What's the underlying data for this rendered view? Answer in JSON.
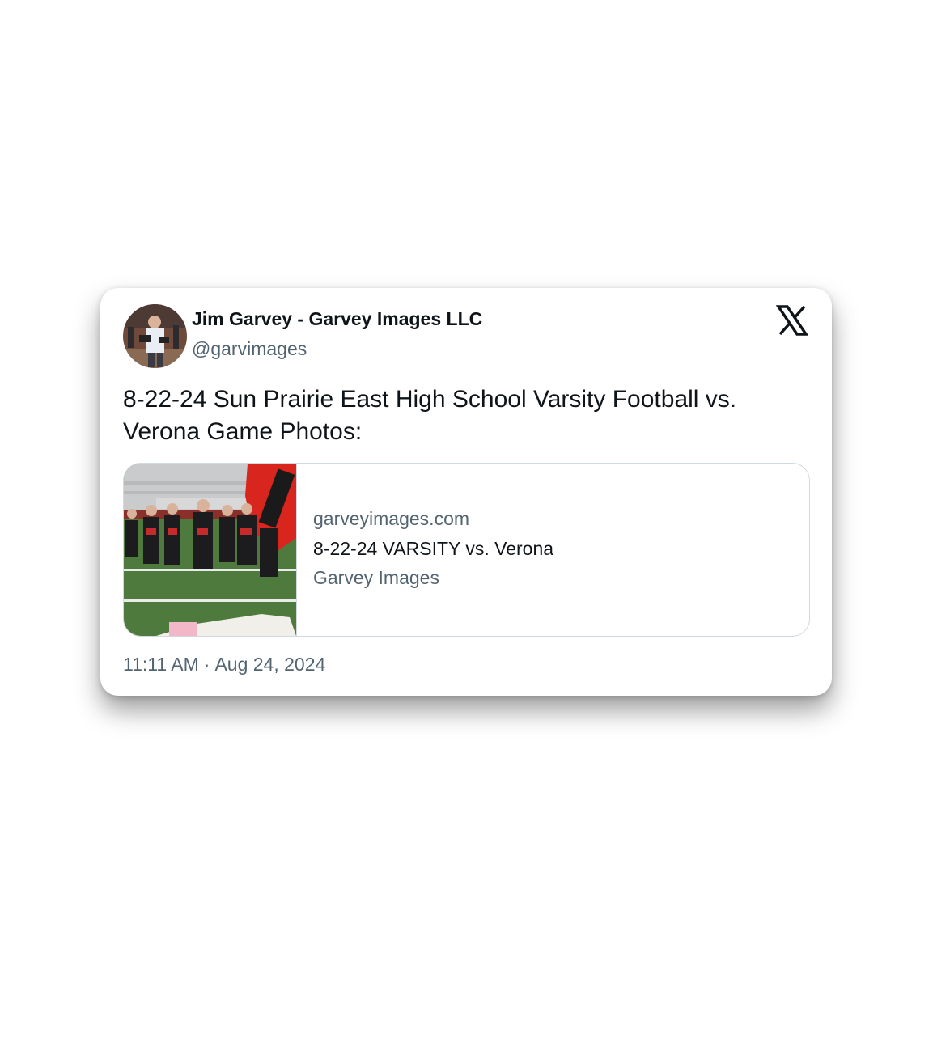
{
  "author": {
    "display_name": "Jim Garvey - Garvey Images LLC",
    "handle": "@garvimages",
    "avatar_icon": "photographer-avatar"
  },
  "platform": {
    "logo_icon": "x-logo-icon"
  },
  "tweet": {
    "text": "8-22-24 Sun Prairie East High School Varsity Football vs. Verona Game Photos:"
  },
  "link_preview": {
    "thumbnail": "football-team-running-onto-field-photo",
    "domain": "garveyimages.com",
    "title": "8-22-24 VARSITY vs. Verona",
    "site_name": "Garvey Images"
  },
  "meta": {
    "time": "11:11 AM",
    "separator": "·",
    "date": "Aug 24, 2024"
  },
  "colors": {
    "text_primary": "#0f1419",
    "text_secondary": "#536471",
    "border": "#cfd9de"
  }
}
